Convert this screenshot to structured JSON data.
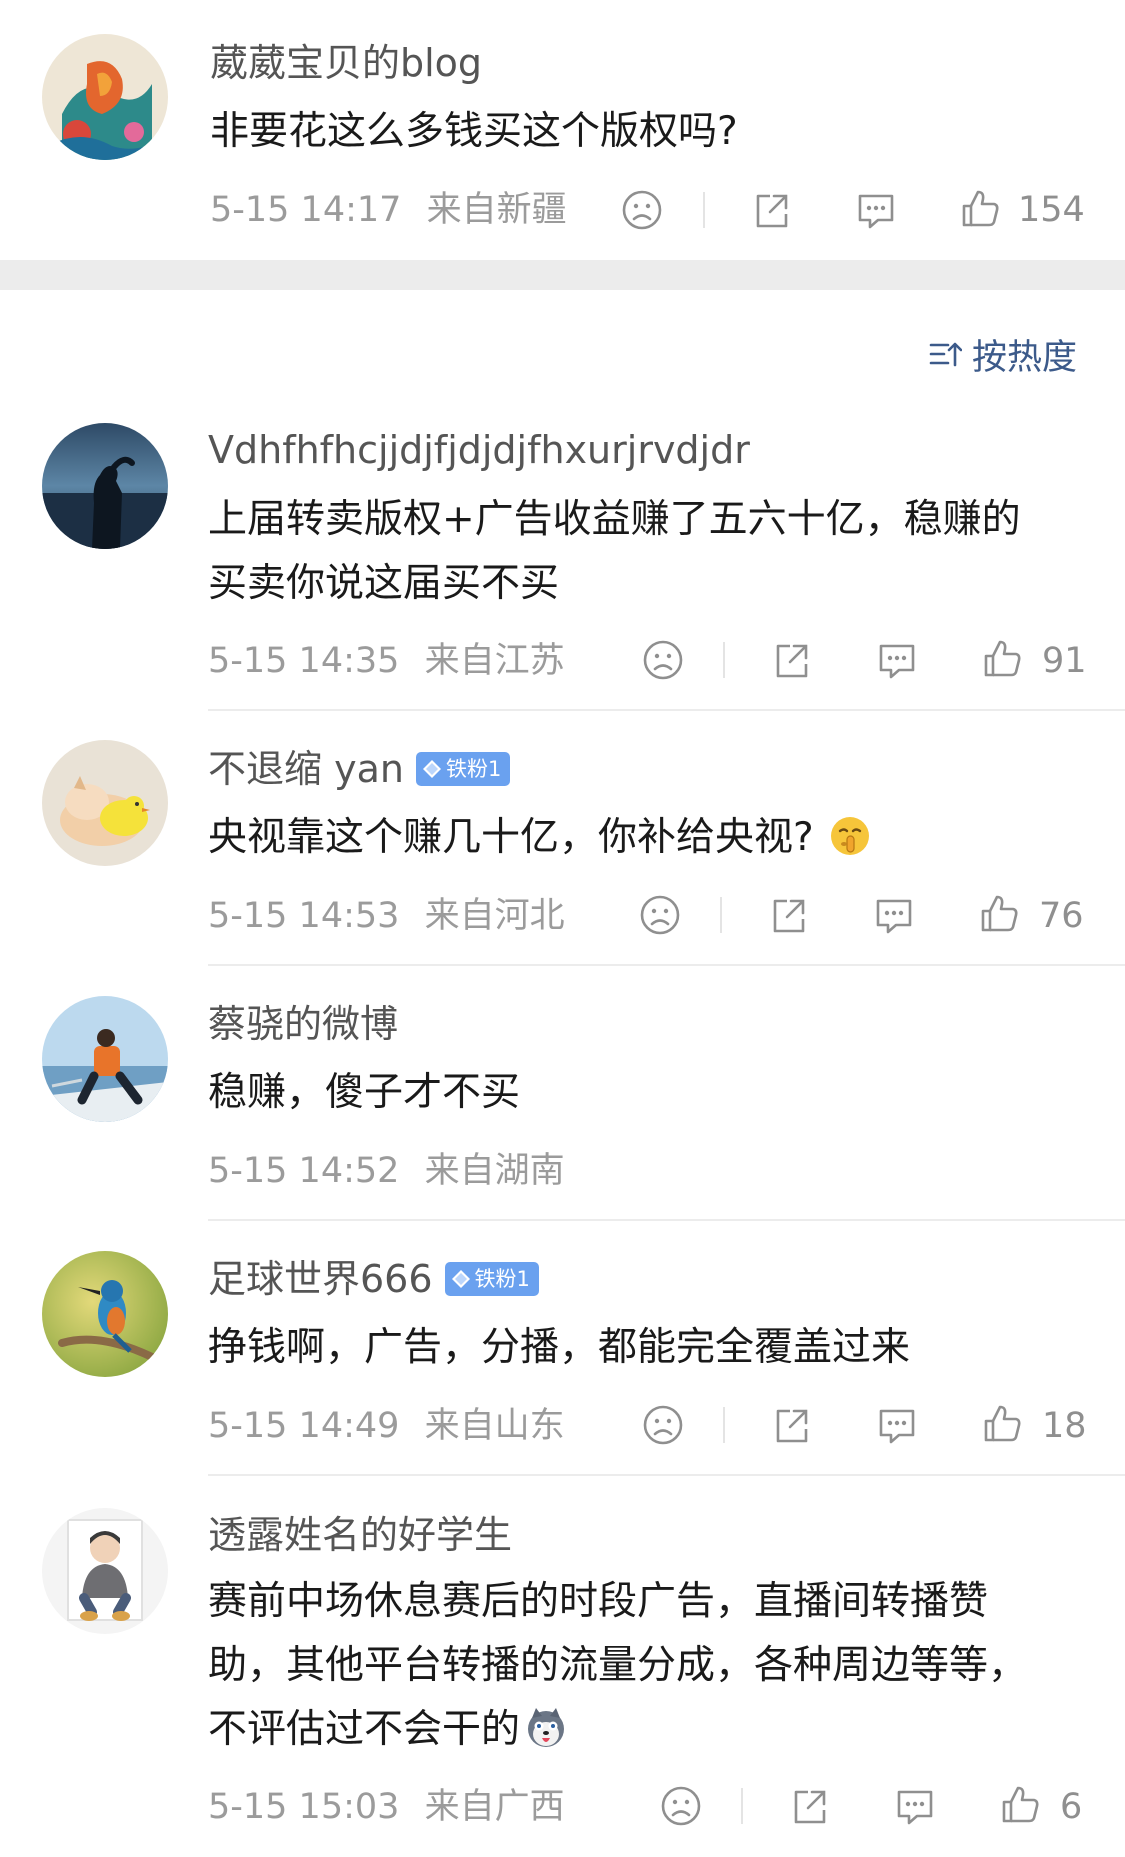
{
  "top_comment": {
    "author": "葳葳宝贝的blog",
    "text": "非要花这么多钱买这个版权吗?",
    "time": "5-15 14:17",
    "location": "来自新疆",
    "likes": "154"
  },
  "sort_label": "按热度",
  "comments": [
    {
      "author": "Vdhfhfhcjjdjfjdjdjfhxurjrvdjdr",
      "text_lines": [
        "上届转卖版权+广告收益赚了五六十亿，稳赚的",
        "买卖你说这届买不买"
      ],
      "time": "5-15 14:35",
      "location": "来自江苏",
      "likes": "91"
    },
    {
      "author": "不退缩 yan",
      "badge": "铁粉1",
      "text_lines": [
        "央视靠这个赚几十亿，你补给央视?"
      ],
      "emoji": "shushing-face",
      "time": "5-15 14:53",
      "location": "来自河北",
      "likes": "76"
    },
    {
      "author": "蔡骁的微博",
      "text_lines": [
        "稳赚，傻子才不买"
      ],
      "time": "5-15 14:52",
      "location": "来自湖南",
      "likes": ""
    },
    {
      "author": "足球世界666",
      "badge": "铁粉1",
      "text_lines": [
        "挣钱啊，广告，分播，都能完全覆盖过来"
      ],
      "time": "5-15 14:49",
      "location": "来自山东",
      "likes": "18"
    },
    {
      "author": "透露姓名的好学生",
      "text_lines": [
        "赛前中场休息赛后的时段广告，直播间转播赞",
        "助，其他平台转播的流量分成，各种周边等等，",
        "不评估过不会干的"
      ],
      "emoji": "husky-face",
      "time": "5-15 15:03",
      "location": "来自广西",
      "likes": "6"
    }
  ],
  "icons": [
    "sad-face-icon",
    "share-icon",
    "comment-icon",
    "thumbs-up-icon",
    "sort-icon",
    "diamond-icon"
  ],
  "colors": {
    "accent_link": "#3c5a8a",
    "badge_bg": "#6aa1ef",
    "meta_gray": "#9b9b9b"
  }
}
